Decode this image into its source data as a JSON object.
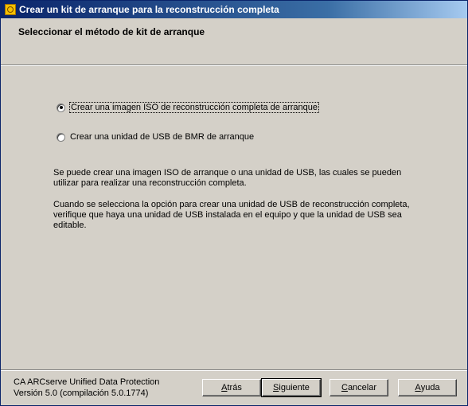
{
  "window": {
    "title": "Crear un kit de arranque para la reconstrucción completa",
    "icon": "ca-arcserve-app-icon"
  },
  "header": {
    "title": "Seleccionar el método de kit de arranque"
  },
  "options": [
    {
      "label": "Crear una imagen ISO de reconstrucción completa de arranque",
      "selected": true
    },
    {
      "label": "Crear una unidad de USB de BMR de arranque",
      "selected": false
    }
  ],
  "description": {
    "para1": "Se puede crear una imagen ISO de arranque o una unidad de USB, las cuales se pueden utilizar para realizar una reconstrucción completa.",
    "para2": "Cuando se selecciona la opción para crear una unidad de USB de reconstrucción completa, verifique que haya una unidad de USB instalada en el equipo y que la unidad de USB sea editable."
  },
  "footer": {
    "product": "CA ARCserve Unified Data Protection",
    "version": "Versión 5.0 (compilación 5.0.1774)"
  },
  "buttons": {
    "back": {
      "first": "A",
      "rest": "trás"
    },
    "next": {
      "first": "S",
      "rest": "iguiente"
    },
    "cancel": {
      "first": "C",
      "rest": "ancelar"
    },
    "help": {
      "first": "A",
      "rest": "yuda"
    }
  }
}
